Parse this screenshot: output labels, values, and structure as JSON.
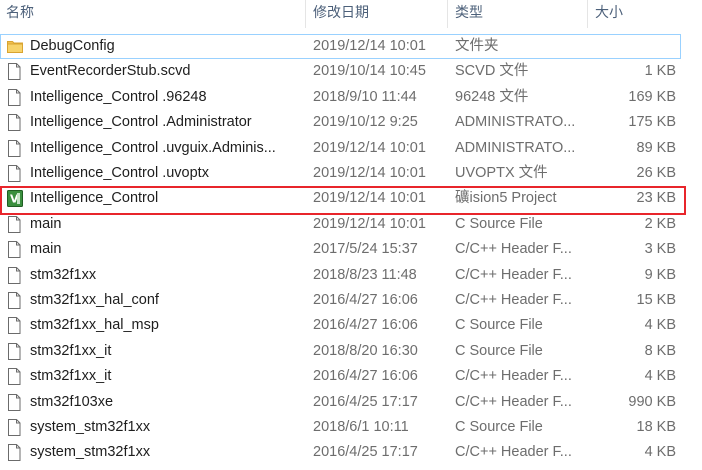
{
  "header": {
    "name": "名称",
    "date": "修改日期",
    "type": "类型",
    "size": "大小"
  },
  "files": [
    {
      "name": "DebugConfig",
      "date": "2019/12/14 10:01",
      "type": "文件夹",
      "size": "",
      "icon": "folder-icon"
    },
    {
      "name": "EventRecorderStub.scvd",
      "date": "2019/10/14 10:45",
      "type": "SCVD 文件",
      "size": "1 KB",
      "icon": "file-icon"
    },
    {
      "name": "Intelligence_Control .96248",
      "date": "2018/9/10 11:44",
      "type": "96248 文件",
      "size": "169 KB",
      "icon": "file-icon"
    },
    {
      "name": "Intelligence_Control .Administrator",
      "date": "2019/10/12 9:25",
      "type": "ADMINISTRATO...",
      "size": "175 KB",
      "icon": "file-icon"
    },
    {
      "name": "Intelligence_Control .uvguix.Adminis...",
      "date": "2019/12/14 10:01",
      "type": "ADMINISTRATO...",
      "size": "89 KB",
      "icon": "file-icon"
    },
    {
      "name": "Intelligence_Control .uvoptx",
      "date": "2019/12/14 10:01",
      "type": "UVOPTX 文件",
      "size": "26 KB",
      "icon": "file-icon"
    },
    {
      "name": "Intelligence_Control",
      "date": "2019/12/14 10:01",
      "type": "礦ision5 Project",
      "size": "23 KB",
      "icon": "keil-project-icon"
    },
    {
      "name": "main",
      "date": "2019/12/14 10:01",
      "type": "C Source File",
      "size": "2 KB",
      "icon": "file-icon"
    },
    {
      "name": "main",
      "date": "2017/5/24 15:37",
      "type": "C/C++ Header F...",
      "size": "3 KB",
      "icon": "file-icon"
    },
    {
      "name": "stm32f1xx",
      "date": "2018/8/23 11:48",
      "type": "C/C++ Header F...",
      "size": "9 KB",
      "icon": "file-icon"
    },
    {
      "name": "stm32f1xx_hal_conf",
      "date": "2016/4/27 16:06",
      "type": "C/C++ Header F...",
      "size": "15 KB",
      "icon": "file-icon"
    },
    {
      "name": "stm32f1xx_hal_msp",
      "date": "2016/4/27 16:06",
      "type": "C Source File",
      "size": "4 KB",
      "icon": "file-icon"
    },
    {
      "name": "stm32f1xx_it",
      "date": "2018/8/20 16:30",
      "type": "C Source File",
      "size": "8 KB",
      "icon": "file-icon"
    },
    {
      "name": "stm32f1xx_it",
      "date": "2016/4/27 16:06",
      "type": "C/C++ Header F...",
      "size": "4 KB",
      "icon": "file-icon"
    },
    {
      "name": "stm32f103xe",
      "date": "2016/4/25 17:17",
      "type": "C/C++ Header F...",
      "size": "990 KB",
      "icon": "file-icon"
    },
    {
      "name": "system_stm32f1xx",
      "date": "2018/6/1 10:11",
      "type": "C Source File",
      "size": "18 KB",
      "icon": "file-icon"
    },
    {
      "name": "system_stm32f1xx",
      "date": "2016/4/25 17:17",
      "type": "C/C++ Header F...",
      "size": "4 KB",
      "icon": "file-icon"
    }
  ],
  "colors": {
    "highlight_border": "#e8252b",
    "selection_border": "#99d1ff",
    "folder": "#f1c050",
    "keil_green": "#2e7d32"
  }
}
